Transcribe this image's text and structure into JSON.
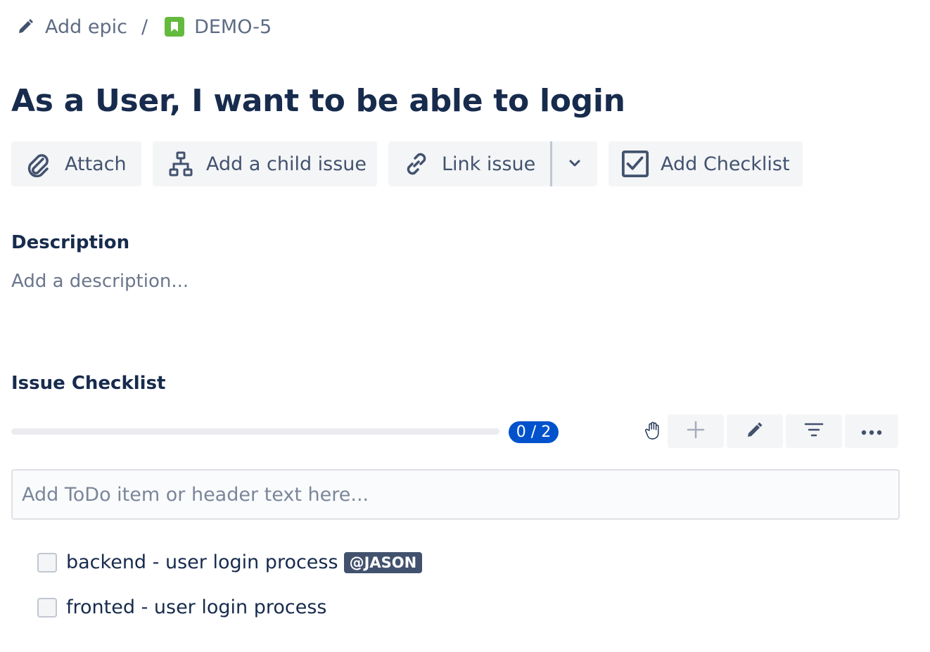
{
  "breadcrumb": {
    "epic_label": "Add epic",
    "separator": "/",
    "issue_key": "DEMO-5",
    "issue_type_color": "#63ba3c"
  },
  "issue": {
    "title": "As a User, I want to be able to login"
  },
  "toolbar": {
    "attach_label": "Attach",
    "child_issue_label": "Add a child issue",
    "link_issue_label": "Link issue",
    "add_checklist_label": "Add Checklist"
  },
  "description": {
    "heading": "Description",
    "placeholder": "Add a description..."
  },
  "checklist": {
    "heading": "Issue Checklist",
    "progress_text": "0 / 2",
    "progress_fraction": 0,
    "input_placeholder": "Add ToDo item or header text here...",
    "items": [
      {
        "text": "backend - user login process",
        "checked": false,
        "mention": "@JASON"
      },
      {
        "text": "fronted - user login process",
        "checked": false
      }
    ],
    "tools": [
      "add-icon",
      "pencil-icon",
      "filter-icon",
      "more-icon"
    ]
  },
  "colors": {
    "accent": "#0052cc",
    "text": "#172b4d",
    "muted": "#6b778c",
    "button_bg": "#f4f5f7",
    "mention_bg": "#42526e"
  }
}
